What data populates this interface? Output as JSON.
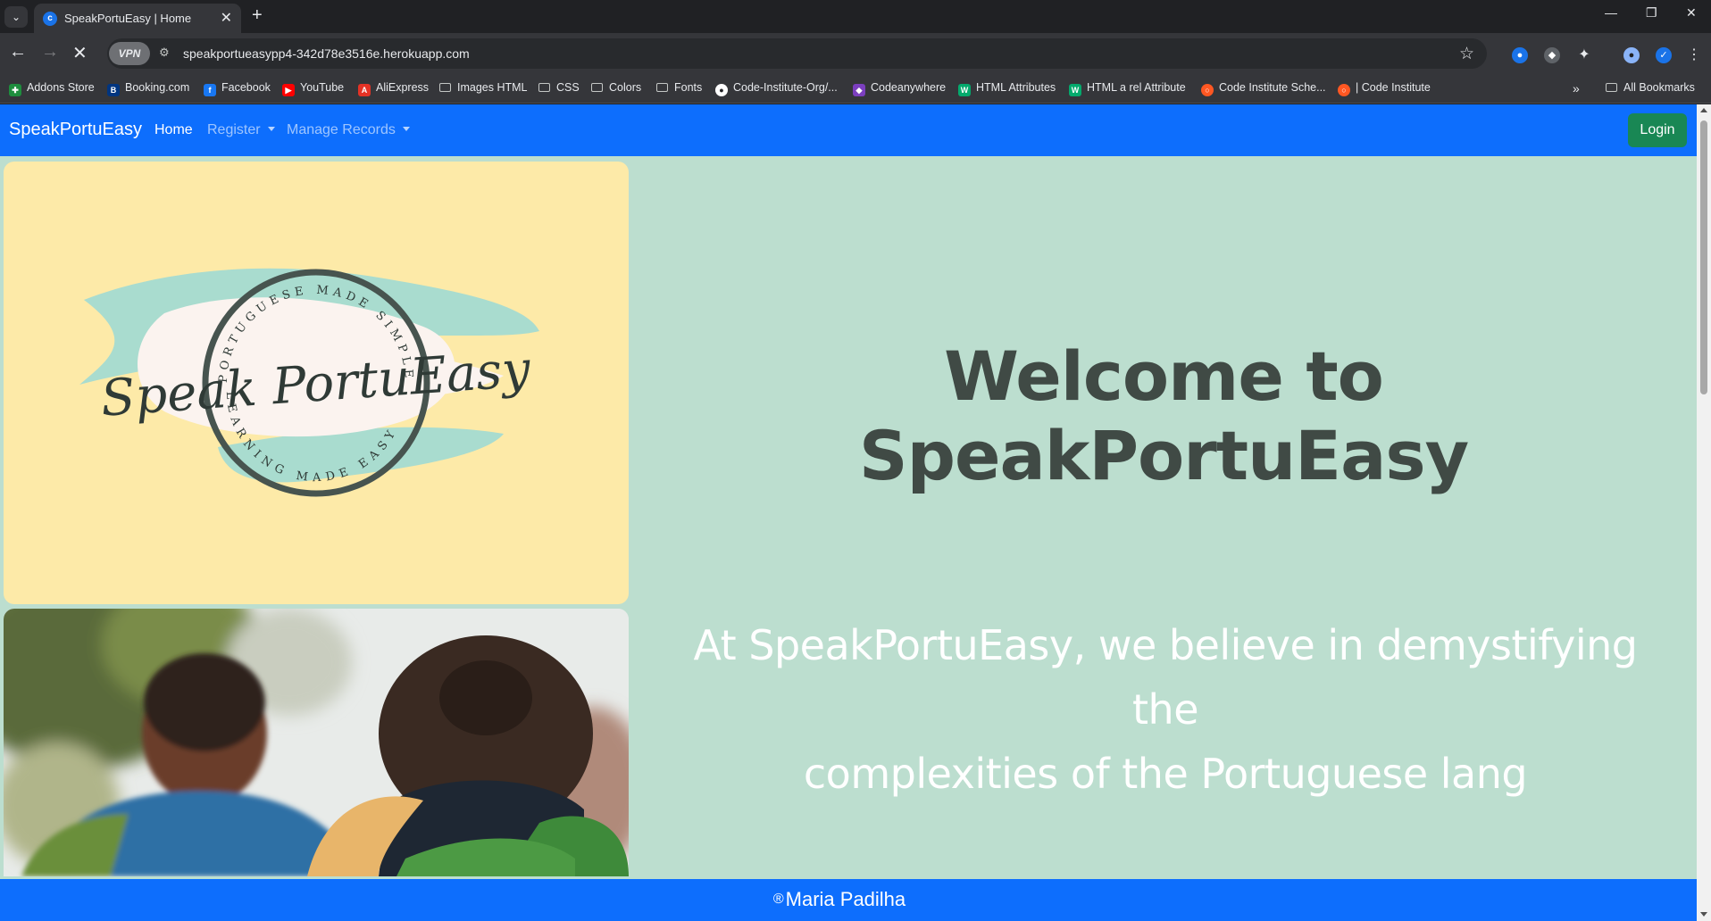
{
  "browser": {
    "tab_title": "SpeakPortuEasy | Home",
    "url": "speakportueasypp4-342d78e3516e.herokuapp.com",
    "vpn_label": "VPN",
    "bookmarks": [
      {
        "label": "Addons Store",
        "icon": "addons-store-icon",
        "color": "#1e8e3e"
      },
      {
        "label": "Booking.com",
        "icon": "booking-icon",
        "color": "#003580"
      },
      {
        "label": "Facebook",
        "icon": "facebook-icon",
        "color": "#1877f2"
      },
      {
        "label": "YouTube",
        "icon": "youtube-icon",
        "color": "#ff0000"
      },
      {
        "label": "AliExpress",
        "icon": "aliexpress-icon",
        "color": "#e43225"
      },
      {
        "label": "Images HTML",
        "icon": "folder-icon"
      },
      {
        "label": "CSS",
        "icon": "folder-icon"
      },
      {
        "label": "Colors",
        "icon": "folder-icon"
      },
      {
        "label": "Fonts",
        "icon": "folder-icon"
      },
      {
        "label": "Code-Institute-Org/...",
        "icon": "github-icon",
        "color": "#ffffff"
      },
      {
        "label": "Codeanywhere",
        "icon": "codeanywhere-icon",
        "color": "#7b3fbf"
      },
      {
        "label": "HTML Attributes",
        "icon": "w3schools-icon",
        "color": "#04aa6d"
      },
      {
        "label": "HTML a rel Attribute",
        "icon": "w3schools-icon",
        "color": "#04aa6d"
      },
      {
        "label": "Code Institute Sche...",
        "icon": "code-institute-icon",
        "color": "#ff5722"
      },
      {
        "label": "| Code Institute",
        "icon": "code-institute-icon",
        "color": "#ff5722"
      }
    ],
    "all_bookmarks": "All Bookmarks"
  },
  "navbar": {
    "brand": "SpeakPortuEasy",
    "links": [
      {
        "label": "Home",
        "active": true
      },
      {
        "label": "Register",
        "dropdown": true
      },
      {
        "label": "Manage Records",
        "dropdown": true
      }
    ],
    "login": "Login"
  },
  "logo": {
    "top_arc": "PORTUGUESE MADE SIMPLE",
    "script": "Speak PortuEasy",
    "bottom_arc": "LEARNING MADE EASY"
  },
  "hero": {
    "heading": "Welcome to SpeakPortuEasy",
    "intro_line1": "At SpeakPortuEasy, we believe in demystifying the",
    "intro_line2": "complexities of the Portuguese lang"
  },
  "footer": {
    "symbol": "®",
    "text": "Maria Padilha"
  },
  "colors": {
    "navbar": "#0d6efd",
    "page_bg": "#bcdecf",
    "login_button": "#198754",
    "logo_bg": "#fdeaa8"
  }
}
